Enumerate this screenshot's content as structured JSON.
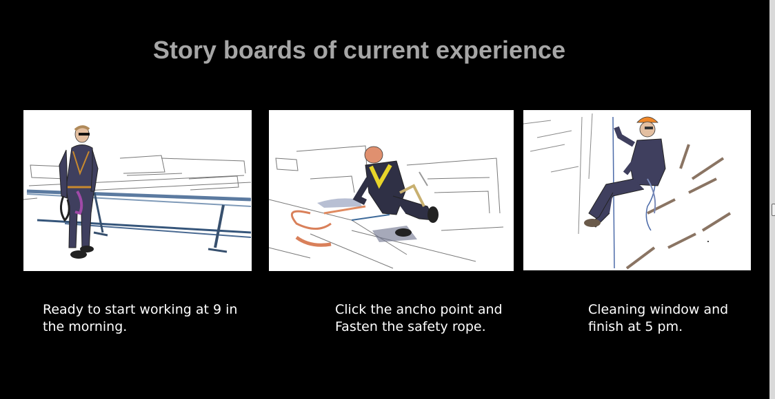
{
  "title": "Story boards of current experience",
  "panels": [
    {
      "illustration": "worker-standing-on-roof",
      "caption": "Ready to start working at 9 in the morning."
    },
    {
      "illustration": "worker-attaching-anchor",
      "caption": "Click the ancho point and Fasten the safety rope."
    },
    {
      "illustration": "worker-rappelling-window",
      "caption": "Cleaning window and finish at 5 pm."
    }
  ],
  "colors": {
    "background": "#000000",
    "title": "#a6a6a6",
    "caption": "#ffffff"
  }
}
